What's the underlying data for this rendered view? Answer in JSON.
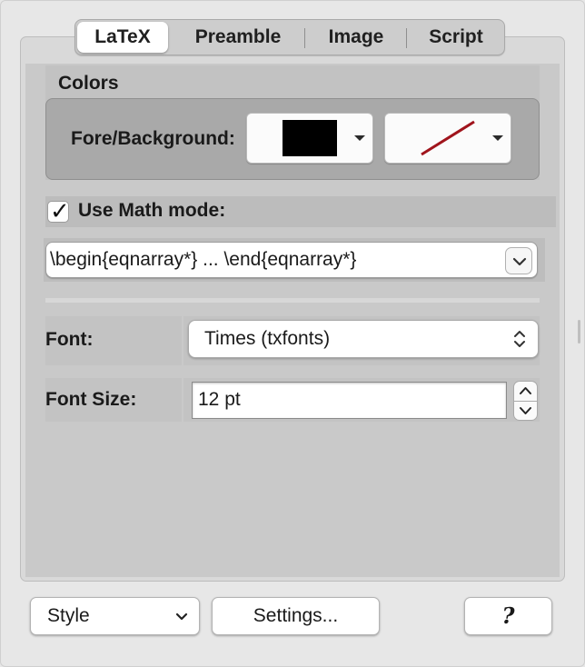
{
  "tabs": [
    "LaTeX",
    "Preamble",
    "Image",
    "Script"
  ],
  "selected_tab": "LaTeX",
  "colors": {
    "title": "Colors",
    "fore_background_label": "Fore/Background:",
    "foreground_color": "#000000",
    "background_state": "none (red slash)"
  },
  "math_mode": {
    "checked": true,
    "label": "Use Math mode:",
    "environment": "\\begin{eqnarray*} ... \\end{eqnarray*}"
  },
  "font": {
    "label": "Font:",
    "value": "Times (txfonts)"
  },
  "font_size": {
    "label": "Font Size:",
    "value": "12 pt"
  },
  "bottom": {
    "style_label": "Style",
    "settings_label": "Settings...",
    "help_label": "?"
  },
  "icons": {
    "checkmark": "✓",
    "chevron_down": "⌄",
    "updown": "⌃⌄"
  }
}
